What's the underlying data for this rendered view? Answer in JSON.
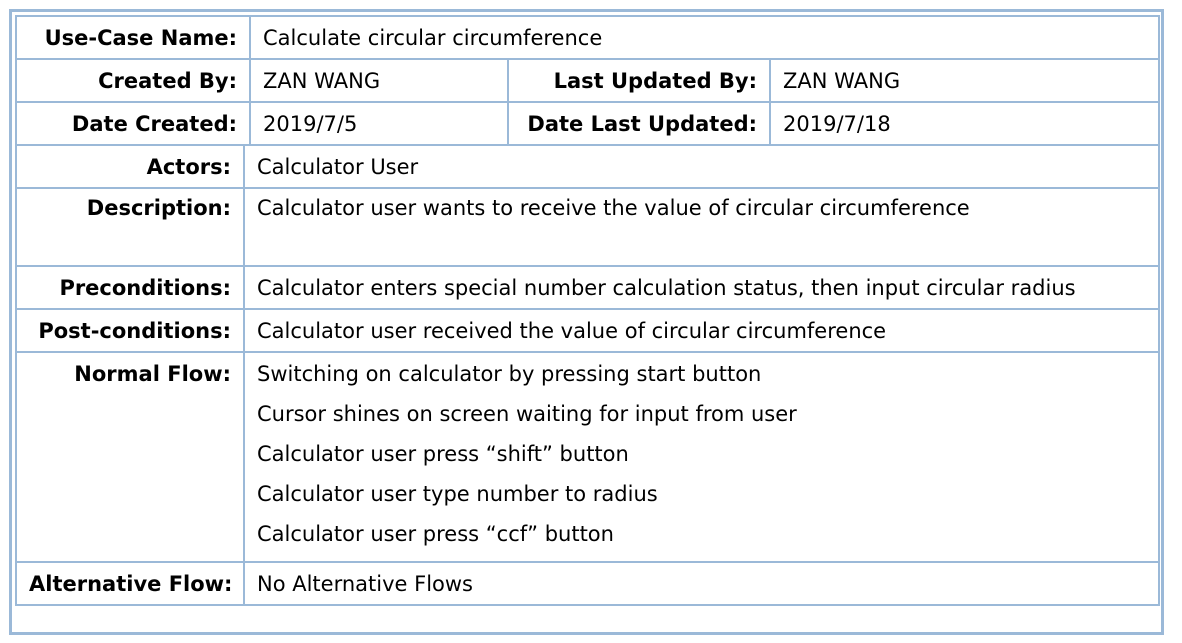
{
  "use_case": {
    "name_label": "Use-Case Name:",
    "name_value": "Calculate circular circumference",
    "created_by_label": "Created By:",
    "created_by_value": "ZAN WANG",
    "last_updated_by_label": "Last Updated By:",
    "last_updated_by_value": "ZAN WANG",
    "date_created_label": "Date Created:",
    "date_created_value": "2019/7/5",
    "date_last_updated_label": "Date Last Updated:",
    "date_last_updated_value": "2019/7/18",
    "actors_label": "Actors:",
    "actors_value": "Calculator User",
    "description_label": "Description:",
    "description_value": "Calculator user wants to receive the value of circular circumference",
    "preconditions_label": "Preconditions:",
    "preconditions_value": "Calculator enters special number calculation status, then input circular radius",
    "postconditions_label": "Post-conditions:",
    "postconditions_value": "Calculator user received the value of circular circumference",
    "normal_flow_label": "Normal Flow:",
    "normal_flow_steps": [
      "Switching on calculator by pressing start button",
      "Cursor shines on screen waiting for input from user",
      "Calculator user press “shift” button",
      "Calculator user type number to radius",
      "Calculator user press “ccf” button"
    ],
    "alternative_flow_label": "Alternative Flow:",
    "alternative_flow_value": "No Alternative Flows"
  },
  "colors": {
    "border": "#9bb9d8",
    "text": "#000000",
    "background": "#ffffff"
  }
}
